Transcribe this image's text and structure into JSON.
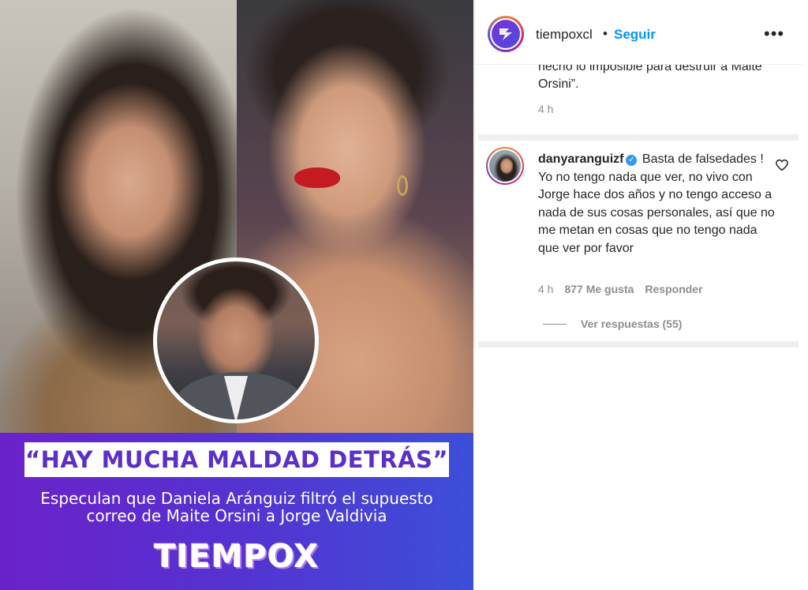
{
  "post_image": {
    "headline": "“HAY MUCHA MALDAD DETRÁS”",
    "subheadline": "Especulan que Daniela Aránguiz filtró el supuesto correo de Maite Orsini a Jorge Valdivia",
    "brand_logo_text": "TIEMPOX",
    "accent_color": "#5b2fc8"
  },
  "header": {
    "username": "tiempoxcl",
    "separator": "•",
    "follow_label": "Seguir",
    "more_label": "•••"
  },
  "previous_comment": {
    "text": "hecho lo imposible para destruir a Maite Orsini”.",
    "time": "4 h"
  },
  "comment": {
    "username": "danyaranguizf",
    "verified": true,
    "text": "Basta de falsedades ! Yo no tengo nada que ver, no vivo con Jorge hace dos años y no tengo acceso a nada de sus cosas personales, así que no me metan en cosas que no tengo nada que ver por favor",
    "time": "4 h",
    "likes": "877 Me gusta",
    "reply_label": "Responder",
    "view_replies": "Ver respuestas (55)"
  },
  "colors": {
    "link_blue": "#0095f6",
    "muted_text": "#8e8e8e",
    "band_purple": "#6b22c9"
  }
}
